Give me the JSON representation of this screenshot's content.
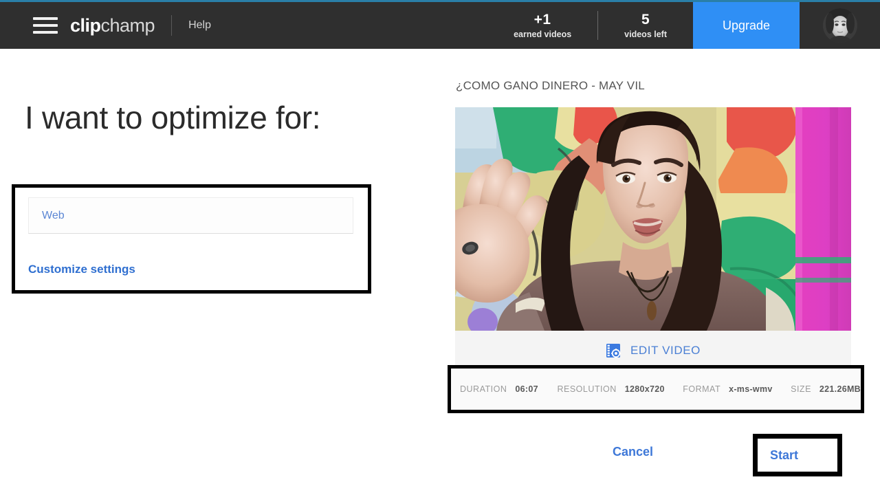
{
  "header": {
    "menu_icon": "hamburger-icon",
    "logo_bold": "clip",
    "logo_light": "champ",
    "help_label": "Help",
    "stats": [
      {
        "number": "+1",
        "label": "earned videos"
      },
      {
        "number": "5",
        "label": "videos left"
      }
    ],
    "upgrade_label": "Upgrade",
    "avatar_icon": "user-avatar",
    "accent_color": "#2f8ff5",
    "bar_color": "#2f2f2f",
    "top_accent_color": "#2a7fa8"
  },
  "left": {
    "heading": "I want to optimize for:",
    "preset_value": "Web",
    "customize_label": "Customize settings",
    "link_color": "#2f6fd0"
  },
  "right": {
    "video_title": "¿COMO GANO DINERO - MAY VIL",
    "edit_video_label": "EDIT VIDEO",
    "edit_video_icon": "film-gear-icon",
    "metadata": [
      {
        "key": "DURATION",
        "value": "06:07"
      },
      {
        "key": "RESOLUTION",
        "value": "1280x720"
      },
      {
        "key": "FORMAT",
        "value": "x-ms-wmv"
      },
      {
        "key": "SIZE",
        "value": "221.26MB"
      }
    ]
  },
  "footer": {
    "cancel_label": "Cancel",
    "start_label": "Start"
  }
}
